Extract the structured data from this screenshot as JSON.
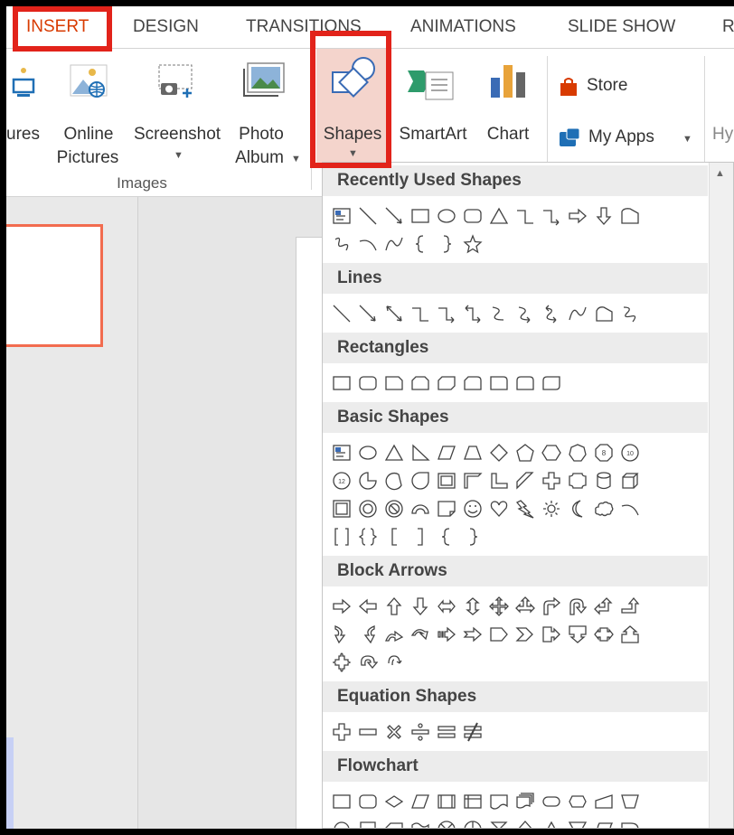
{
  "tabs": [
    {
      "label": "INSERT",
      "active": true
    },
    {
      "label": "DESIGN"
    },
    {
      "label": "TRANSITIONS"
    },
    {
      "label": "ANIMATIONS"
    },
    {
      "label": "SLIDE SHOW"
    },
    {
      "label": "R"
    }
  ],
  "ribbon": {
    "pictures_label": "ures",
    "online_pictures": [
      "Online",
      "Pictures"
    ],
    "screenshot_label": "Screenshot",
    "photo_album": [
      "Photo",
      "Album"
    ],
    "images_group_label": "Images",
    "shapes_label": "Shapes",
    "smartart_label": "SmartArt",
    "chart_label": "Chart",
    "store_label": "Store",
    "myapps_label": "My Apps",
    "hy_label": "Hy"
  },
  "dropdown": {
    "sections": [
      {
        "title": "Recently Used Shapes",
        "rows": [
          [
            "textbox",
            "line",
            "arrow-line",
            "rect",
            "oval",
            "rounded-rect",
            "triangle",
            "elbow",
            "elbow-arrow",
            "right-arrow",
            "down-arrow",
            "flow-snip"
          ],
          [
            "freeform",
            "arc",
            "curve",
            "left-brace",
            "right-brace",
            "star"
          ]
        ]
      },
      {
        "title": "Lines",
        "rows": [
          [
            "line",
            "arrow-line",
            "double-arrow-line",
            "elbow",
            "elbow-arrow",
            "elbow-double",
            "curved",
            "curved-arrow",
            "curved-double",
            "curve",
            "freeform-closed",
            "scribble"
          ]
        ]
      },
      {
        "title": "Rectangles",
        "rows": [
          [
            "rect",
            "rounded-rect",
            "snip-one",
            "snip-same",
            "snip-diag",
            "snip-round",
            "round-one",
            "round-same",
            "round-diag"
          ]
        ]
      },
      {
        "title": "Basic Shapes",
        "rows": [
          [
            "textbox",
            "oval",
            "triangle",
            "right-triangle",
            "parallelogram",
            "trapezoid",
            "diamond",
            "pentagon",
            "hexagon",
            "heptagon",
            "octagon",
            "decagon"
          ],
          [
            "dodecagon",
            "pie",
            "chord",
            "teardrop",
            "frame",
            "half-frame",
            "l-shape",
            "diag-stripe",
            "cross",
            "plaque",
            "can",
            "cube"
          ],
          [
            "bevel",
            "donut",
            "no-symbol",
            "block-arc",
            "folded-corner",
            "smiley",
            "heart",
            "lightning",
            "sun",
            "moon",
            "cloud",
            "arc"
          ],
          [
            "double-bracket",
            "double-brace",
            "left-bracket",
            "right-bracket",
            "left-brace",
            "right-brace"
          ]
        ]
      },
      {
        "title": "Block Arrows",
        "rows": [
          [
            "right-arrow",
            "left-arrow",
            "up-arrow",
            "down-arrow",
            "left-right-arrow",
            "up-down-arrow",
            "quad-arrow",
            "left-right-up",
            "bent-arrow",
            "u-turn",
            "left-up-arrow",
            "bent-up-arrow"
          ],
          [
            "curved-right",
            "curved-left",
            "curved-up",
            "curved-down",
            "striped-right",
            "notched-right",
            "pentagon-arrow",
            "chevron",
            "right-callout",
            "down-callout",
            "left-right-callout",
            "up-callout"
          ],
          [
            "quad-callout",
            "circular-arrow",
            "u-turn-small"
          ]
        ]
      },
      {
        "title": "Equation Shapes",
        "rows": [
          [
            "plus",
            "minus",
            "multiply",
            "divide",
            "equal",
            "not-equal"
          ]
        ]
      },
      {
        "title": "Flowchart",
        "rows": [
          [
            "process",
            "alternate-process",
            "decision",
            "data",
            "predefined",
            "internal-storage",
            "document",
            "multidocument",
            "terminator",
            "preparation",
            "manual-input",
            "manual-operation"
          ],
          [
            "connector",
            "offpage",
            "card",
            "punched-tape",
            "summing",
            "or",
            "collate",
            "sort",
            "extract",
            "merge",
            "stored-data",
            "delay"
          ]
        ]
      }
    ]
  },
  "colors": {
    "highlight": "#e2231a",
    "active_tab": "#d83b01",
    "shape_stroke": "#444444",
    "section_bg": "#ececec",
    "slide_border": "#f26c4f"
  }
}
